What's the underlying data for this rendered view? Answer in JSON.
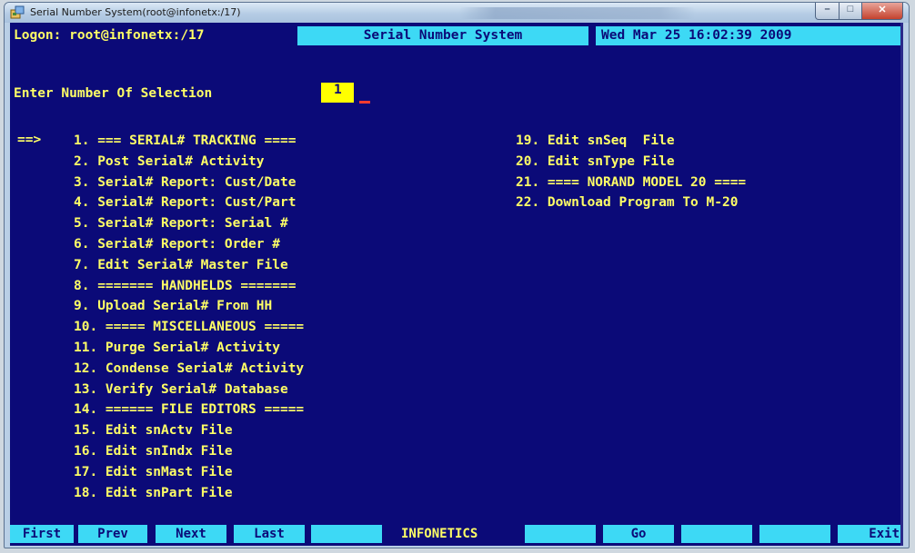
{
  "window": {
    "title": "Serial Number System(root@infonetx:/17)",
    "minimize_glyph": "–",
    "maximize_glyph": "□",
    "close_glyph": "✕"
  },
  "header": {
    "logon": "Logon: root@infonetx:/17",
    "title": "Serial Number System",
    "datetime": "Wed Mar 25 16:02:39 2009"
  },
  "prompt": {
    "label": "Enter Number Of Selection",
    "value": "1"
  },
  "current_marker": "==>",
  "menu_left": [
    "1. === SERIAL# TRACKING ====",
    "2. Post Serial# Activity",
    "3. Serial# Report: Cust/Date",
    "4. Serial# Report: Cust/Part",
    "5. Serial# Report: Serial #",
    "6. Serial# Report: Order #",
    "7. Edit Serial# Master File",
    "8. ======= HANDHELDS =======",
    "9. Upload Serial# From HH",
    "10. ===== MISCELLANEOUS =====",
    "11. Purge Serial# Activity",
    "12. Condense Serial# Activity",
    "13. Verify Serial# Database",
    "14. ====== FILE EDITORS =====",
    "15. Edit snActv File",
    "16. Edit snIndx File",
    "17. Edit snMast File",
    "18. Edit snPart File"
  ],
  "menu_right": [
    "19. Edit snSeq  File",
    "20. Edit snType File",
    "21. ==== NORAND MODEL 20 ====",
    "22. Download Program To M-20"
  ],
  "function_keys": {
    "first": "First",
    "prev": "Prev",
    "next": "Next",
    "last": "Last",
    "center_label": "INFONETICS",
    "go": "Go",
    "exit": "Exit"
  },
  "colors": {
    "background": "#0b0a78",
    "text": "#ffff66",
    "highlight": "#3dd9f5",
    "input_bg": "#ffff00"
  }
}
